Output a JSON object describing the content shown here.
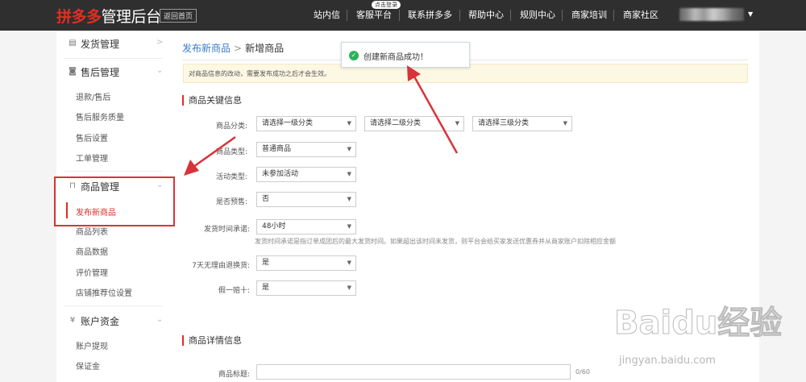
{
  "header": {
    "logo_brand": "拼多多",
    "logo_rest": "管理后台",
    "home_button": "返回首页",
    "nav": [
      "站内信",
      "客服平台",
      "联系拼多多",
      "帮助中心",
      "规则中心",
      "商家培训",
      "商家社区"
    ],
    "nav_badge": "点击登录",
    "user_caret": "▼"
  },
  "sidebar": {
    "groups": [
      {
        "icon": "box-icon",
        "label": "发货管理",
        "items": []
      },
      {
        "icon": "shield-icon",
        "label": "售后管理",
        "items": [
          "退款/售后",
          "售后服务质量",
          "售后设置",
          "工单管理"
        ]
      },
      {
        "icon": "bag-icon",
        "label": "商品管理",
        "items": [
          "发布新商品",
          "商品列表",
          "商品数据",
          "评价管理",
          "店铺推荐位设置"
        ]
      },
      {
        "icon": "yen-icon",
        "label": "账户资金",
        "items": [
          "账户提现",
          "保证金"
        ]
      }
    ],
    "active_item": "发布新商品"
  },
  "main": {
    "breadcrumb": {
      "parent": "发布新商品",
      "sep": ">",
      "current": "新增商品"
    },
    "notice": "对商品信息的改动，需要发布成功之后才会生效。",
    "section1": "商品关键信息",
    "fields": {
      "category_label": "商品分类:",
      "category1": "请选择一级分类",
      "category2": "请选择二级分类",
      "category3": "请选择三级分类",
      "type_label": "商品类型:",
      "type_value": "普通商品",
      "activity_label": "活动类型:",
      "activity_value": "未参加活动",
      "presale_label": "是否预售:",
      "presale_value": "否",
      "ship_label": "发货时间承诺:",
      "ship_value": "48小时",
      "ship_hint": "发货时间承诺是指订单成团后的最大发货时间。如果超出该时间未发货，则平台会给买家发送优惠券并从商家账户扣除相应金额",
      "return_label": "7天无理由退换货:",
      "return_value": "是",
      "fake_label": "假一赔十:",
      "fake_value": "是"
    },
    "section2": "商品详情信息",
    "title_label": "商品标题:",
    "title_counter": "0/60"
  },
  "toast": {
    "message": "创建新商品成功！"
  },
  "watermark": {
    "big": "Baidu经验",
    "small": "jingyan.baidu.com"
  },
  "colors": {
    "brand_red": "#e02e24",
    "link_blue": "#3b7bc4",
    "topbar": "#2f2f2f",
    "annotation_red": "#d9333a",
    "success_green": "#2bb35a"
  }
}
